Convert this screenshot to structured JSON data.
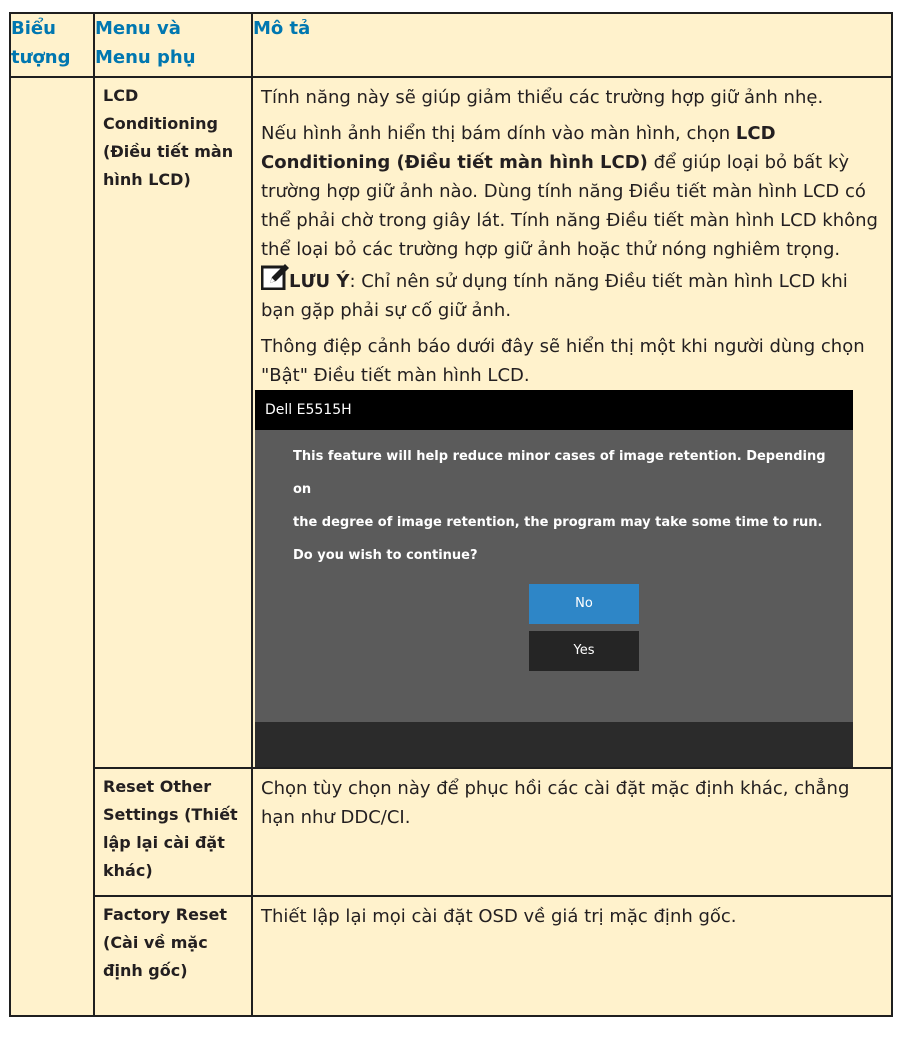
{
  "table": {
    "headers": {
      "icon_line1": "Biểu",
      "icon_line2": "tượng",
      "menu_line1": "Menu và",
      "menu_line2": "Menu phụ",
      "desc": "Mô tả"
    },
    "rows": [
      {
        "submenu": "LCD Conditioning (Điều tiết màn hình LCD)",
        "p1": "Tính năng này sẽ giúp giảm thiểu các trường hợp giữ ảnh nhẹ.",
        "p2_before": "Nếu hình ảnh hiển thị bám dính vào màn hình, chọn ",
        "p2_bold": "LCD Conditioning (Điều tiết màn hình LCD)",
        "p2_after": " để giúp loại bỏ bất kỳ trường hợp giữ ảnh nào. Dùng tính năng Điều tiết màn hình LCD có thể phải chờ trong giây lát. Tính năng Điều tiết màn hình LCD không thể loại bỏ các trường hợp giữ ảnh hoặc thử nóng nghiêm trọng.",
        "note_label": "LƯU Ý",
        "note_text": ": Chỉ nên sử dụng tính năng Điều tiết màn hình LCD khi bạn gặp phải sự cố giữ ảnh.",
        "p3": "Thông điệp cảnh báo dưới đây sẽ hiển thị một khi người dùng chọn \"Bật\" Điều tiết màn hình LCD."
      },
      {
        "submenu": "Reset Other Settings (Thiết lập lại cài đặt khác)",
        "desc": "Chọn tùy chọn này để phục hồi các cài đặt mặc định khác, chẳng hạn như DDC/CI."
      },
      {
        "submenu": "Factory Reset (Cài về mặc định gốc)",
        "desc": "Thiết lập lại mọi cài đặt OSD về giá trị mặc định gốc."
      }
    ]
  },
  "osd_dialog": {
    "title": "Dell E5515H",
    "line1": "This feature will help reduce minor cases of image retention. Depending on",
    "line2": "the degree of image retention, the program may take some time to run.",
    "line3": "Do you wish to continue?",
    "no_label": "No",
    "yes_label": "Yes",
    "colors": {
      "no_button": "#2e86c7",
      "yes_button": "#252525",
      "panel": "#5b5b5b",
      "title_bar": "#000000"
    }
  },
  "icons": {
    "note": "pencil-note-icon"
  },
  "colors": {
    "header_text": "#0077b0",
    "cell_background": "#fff2cc"
  }
}
